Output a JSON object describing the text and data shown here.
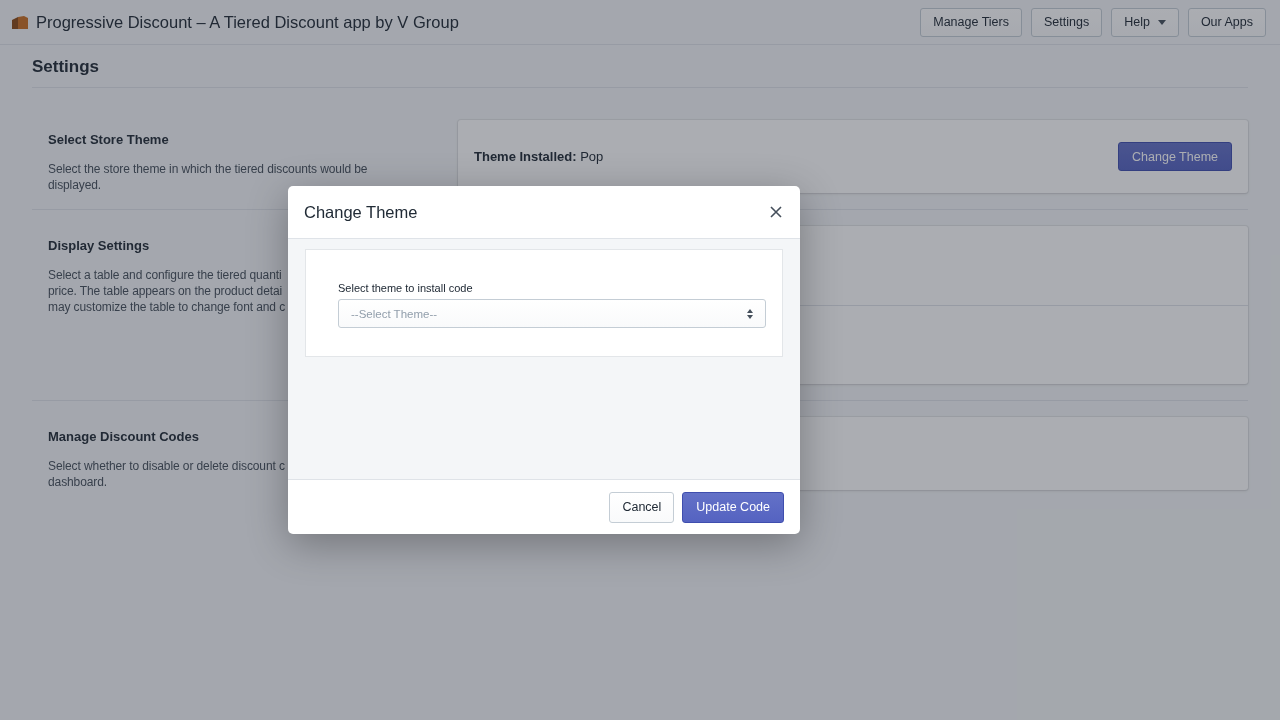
{
  "header": {
    "title": "Progressive Discount – A Tiered Discount app by V Group",
    "nav_buttons": [
      {
        "label": "Manage Tiers",
        "kind": "button"
      },
      {
        "label": "Settings",
        "kind": "button"
      },
      {
        "label": "Help",
        "kind": "dropdown"
      },
      {
        "label": "Our Apps",
        "kind": "button"
      }
    ]
  },
  "page_title": "Settings",
  "sections": [
    {
      "title": "Select Store Theme",
      "description_lines": [
        "Select the store theme in which the tiered discounts would be",
        "displayed."
      ],
      "card": {
        "kind": "status",
        "text": "**Theme Installed:** Pop",
        "button": "Change Theme"
      }
    },
    {
      "title": "Display Settings",
      "description_lines": [
        "Select a table and configure the tiered quanti",
        "price. The table appears on the product detai",
        "may customize the table to change font and c"
      ],
      "card": {
        "kind": "split"
      }
    },
    {
      "title": "Manage Discount Codes",
      "description_lines": [
        "Select whether to disable or delete discount c",
        "dashboard."
      ],
      "card": {
        "kind": "plain"
      }
    }
  ],
  "modal": {
    "title": "Change Theme",
    "field_label": "Select theme to install code",
    "select": {
      "placeholder": "--Select Theme--"
    },
    "buttons": [
      {
        "label": "Cancel",
        "primary": false
      },
      {
        "label": "Update Code",
        "primary": true
      }
    ]
  }
}
